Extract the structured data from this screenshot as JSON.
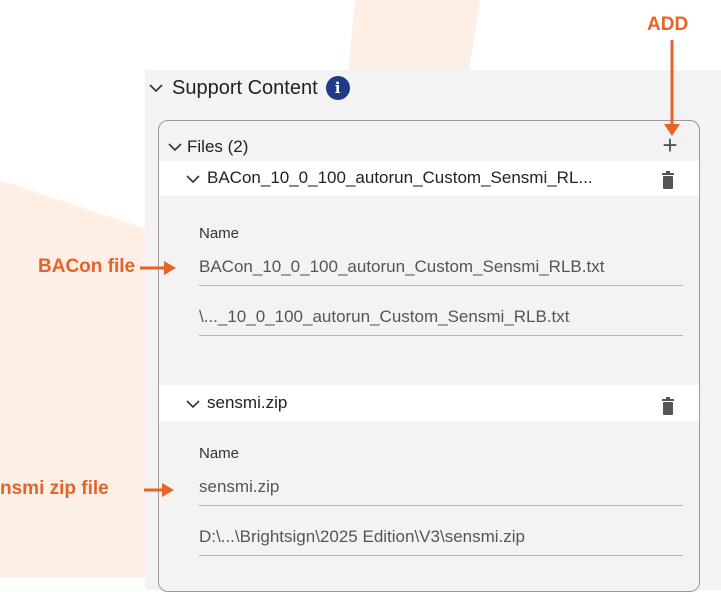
{
  "section": {
    "title": "Support Content",
    "info_icon": "info-icon"
  },
  "files": {
    "header": "Files (2)",
    "add_icon": "+",
    "items": [
      {
        "title": "BACon_10_0_100_autorun_Custom_Sensmi_RL...",
        "name_label": "Name",
        "name_value": "BACon_10_0_100_autorun_Custom_Sensmi_RLB.txt",
        "path_value": "\\..._10_0_100_autorun_Custom_Sensmi_RLB.txt"
      },
      {
        "title": "sensmi.zip",
        "name_label": "Name",
        "name_value": "sensmi.zip",
        "path_value": "D:\\...\\Brightsign\\2025 Edition\\V3\\sensmi.zip"
      }
    ]
  },
  "annotations": {
    "add": "ADD",
    "bacon_file": "BACon file",
    "zip_file": "nsmi zip file"
  },
  "colors": {
    "accent": "#e8632a",
    "info": "#1f3b84"
  }
}
